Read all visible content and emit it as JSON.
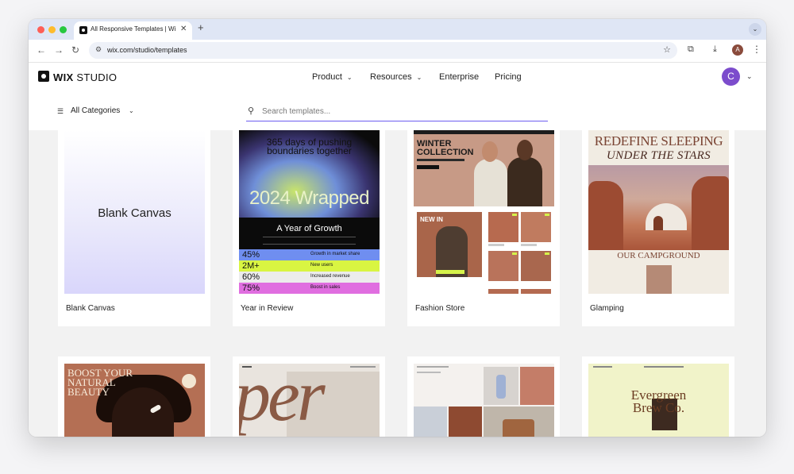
{
  "browser": {
    "tab_title": "All Responsive Templates | Wix",
    "tab_close": "✕",
    "new_tab": "+",
    "tab_menu": "⌄",
    "url": "wix.com/studio/templates",
    "profile_initial": "A"
  },
  "header": {
    "logo_bold": "WIX",
    "logo_light": " STUDIO",
    "nav": [
      {
        "label": "Product",
        "has_dropdown": true
      },
      {
        "label": "Resources",
        "has_dropdown": true
      },
      {
        "label": "Enterprise",
        "has_dropdown": false
      },
      {
        "label": "Pricing",
        "has_dropdown": false
      }
    ],
    "user_initial": "C",
    "avatar_color": "#7c4ccc"
  },
  "filters": {
    "category_label": "All Categories",
    "search_placeholder": "Search templates..."
  },
  "templates": [
    {
      "title": "Blank Canvas",
      "preview_text": "Blank Canvas"
    },
    {
      "title": "Year in Review",
      "preview": {
        "headline": "365 days of pushing boundaries together",
        "big": "2024 Wrapped",
        "sub": "A Year of Growth",
        "stats": [
          {
            "value": "45%",
            "label": "Growth in market share",
            "color": "#6f8ef0"
          },
          {
            "value": "2M+",
            "label": "New users",
            "color": "#d9f542"
          },
          {
            "value": "60%",
            "label": "Increased revenue",
            "color": "#ececec"
          },
          {
            "value": "75%",
            "label": "Boost in sales",
            "color": "#e06ee0"
          }
        ]
      }
    },
    {
      "title": "Fashion Store",
      "preview": {
        "headline": "WINTER COLLECTION",
        "badge": "NEW IN"
      }
    },
    {
      "title": "Glamping",
      "preview": {
        "headline": "REDEFINE SLEEPING",
        "sub": "UNDER THE STARS",
        "section": "OUR CAMPGROUND"
      }
    },
    {
      "title": "",
      "preview": {
        "headline": "BOOST YOUR NATURAL BEAUTY"
      }
    },
    {
      "title": "",
      "preview": {
        "headline": "per"
      }
    },
    {
      "title": "",
      "preview": {}
    },
    {
      "title": "",
      "preview": {
        "headline": "Evergreen Brew Co."
      }
    }
  ],
  "colors": {
    "accent": "#6d5ef0",
    "page_bg": "#f2f2f2"
  }
}
